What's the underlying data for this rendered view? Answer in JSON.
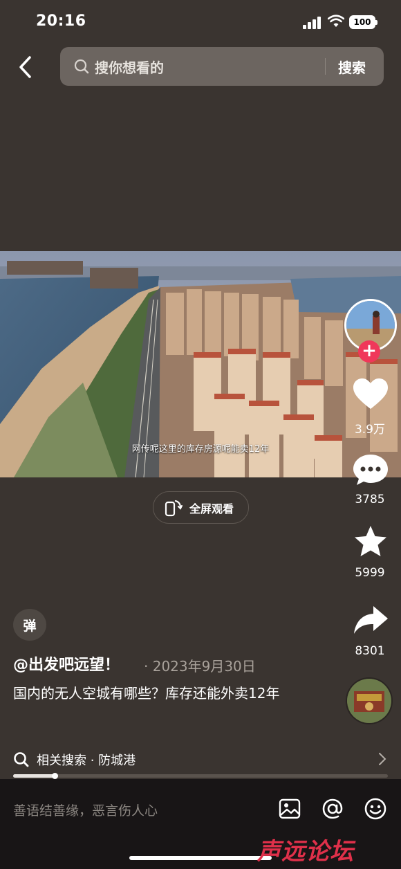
{
  "status_bar": {
    "time": "20:16",
    "battery": "100"
  },
  "search": {
    "placeholder": "搜你想看的",
    "submit_label": "搜索"
  },
  "video": {
    "subtitle": "网传呢这里的库存房源呢能卖12年",
    "fullscreen_label": "全屏观看",
    "progress": 0.11
  },
  "actions": {
    "likes": "3.9万",
    "comments": "3785",
    "favorites": "5999",
    "shares": "8301"
  },
  "post": {
    "danmu_label": "弹",
    "author": "@出发吧远望！",
    "date": "· 2023年9月30日",
    "caption": "国内的无人空城有哪些？库存还能外卖12年"
  },
  "related": {
    "label": "相关搜索 · 防城港"
  },
  "comment_bar": {
    "placeholder": "善语结善缘，恶言伤人心"
  },
  "watermark": "声远论坛",
  "colors": {
    "accent": "#f0385a",
    "background": "#3a3430",
    "bottom_bar": "#181516"
  },
  "icons": [
    "back-arrow-icon",
    "search-icon",
    "phone-rotate-icon",
    "heart-icon",
    "comment-bubble-icon",
    "star-icon",
    "share-arrow-icon",
    "image-icon",
    "at-icon",
    "emoji-icon",
    "chevron-right-icon"
  ]
}
